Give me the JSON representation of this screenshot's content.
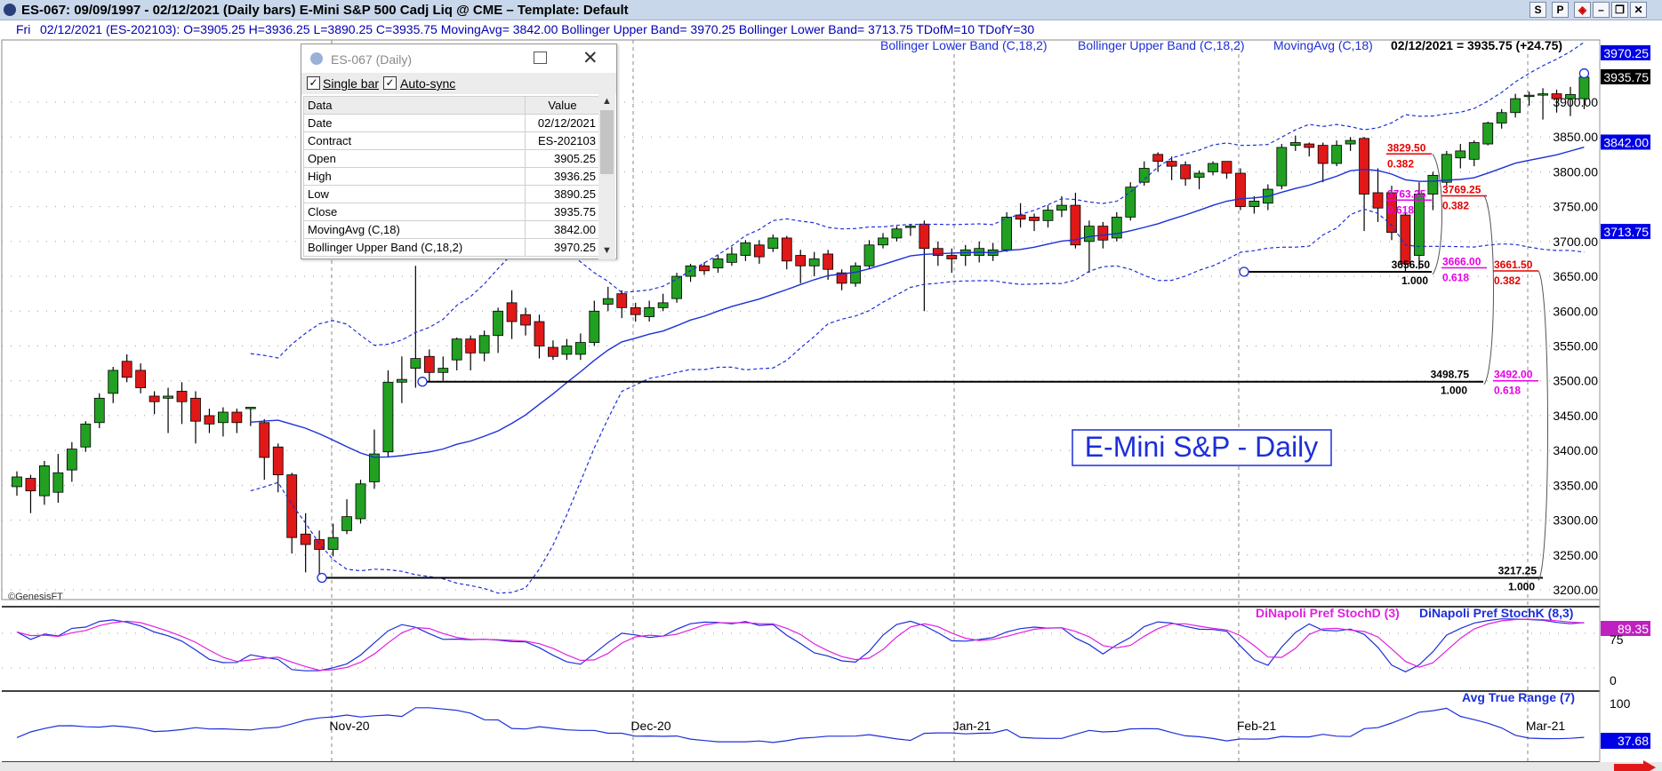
{
  "window": {
    "title": "ES-067:  09/09/1997 - 02/12/2021  (Daily bars)   E-Mini S&P 500 Cadj Liq @ CME  –  Template: Default",
    "buttons": [
      "S",
      "P"
    ]
  },
  "infobar": {
    "day": "Fri",
    "text": "02/12/2021 (ES-202103):  O=3905.25  H=3936.25  L=3890.25  C=3935.75  MovingAvg= 3842.00  Bollinger Upper Band= 3970.25  Bollinger Lower Band= 3713.75  TDofM=10  TDofY=30"
  },
  "data_window": {
    "title": "ES-067 (Daily)",
    "single_bar": "Single bar",
    "auto_sync": "Auto-sync",
    "headers": [
      "Data",
      "Value"
    ],
    "rows": [
      [
        "Date",
        "02/12/2021"
      ],
      [
        "Contract",
        "ES-202103"
      ],
      [
        "Open",
        "3905.25"
      ],
      [
        "High",
        "3936.25"
      ],
      [
        "Low",
        "3890.25"
      ],
      [
        "Close",
        "3935.75"
      ],
      [
        "MovingAvg (C,18)",
        "3842.00"
      ],
      [
        "Bollinger Upper Band (C,18,2)",
        "3970.25"
      ]
    ]
  },
  "chart_data": {
    "type": "candlestick",
    "title": "E-Mini S&P - Daily",
    "copyright": "©GenesisFT",
    "legend": [
      "Bollinger Lower Band (C,18,2)",
      "Bollinger Upper Band (C,18,2)",
      "MovingAvg (C,18)"
    ],
    "last_value_text": "02/12/2021 = 3935.75 (+24.75)",
    "x_ticks": [
      "Nov-20",
      "Dec-20",
      "Jan-21",
      "Feb-21",
      "Mar-21"
    ],
    "y_ticks": [
      "3200.00",
      "3250.00",
      "3300.00",
      "3350.00",
      "3400.00",
      "3450.00",
      "3500.00",
      "3550.00",
      "3600.00",
      "3650.00",
      "3700.00",
      "3750.00",
      "3800.00",
      "3850.00",
      "3900.00"
    ],
    "ylim": [
      3195,
      3985
    ],
    "price_labels": [
      {
        "text": "3970.25",
        "value": 3970.25,
        "color": "#0000e6"
      },
      {
        "text": "3935.75",
        "value": 3935.75,
        "color": "#000000"
      },
      {
        "text": "3842.00",
        "value": 3842.0,
        "color": "#0000e6"
      },
      {
        "text": "3713.75",
        "value": 3713.75,
        "color": "#0000e6"
      }
    ],
    "candles": [
      [
        3348,
        3362,
        3335,
        3370
      ],
      [
        3360,
        3342,
        3310,
        3365
      ],
      [
        3335,
        3378,
        3322,
        3385
      ],
      [
        3340,
        3368,
        3325,
        3395
      ],
      [
        3372,
        3402,
        3355,
        3412
      ],
      [
        3405,
        3438,
        3398,
        3442
      ],
      [
        3440,
        3475,
        3432,
        3482
      ],
      [
        3482,
        3515,
        3468,
        3520
      ],
      [
        3528,
        3505,
        3498,
        3538
      ],
      [
        3515,
        3490,
        3482,
        3525
      ],
      [
        3478,
        3470,
        3452,
        3485
      ],
      [
        3475,
        3478,
        3425,
        3490
      ],
      [
        3485,
        3470,
        3438,
        3498
      ],
      [
        3475,
        3442,
        3410,
        3485
      ],
      [
        3450,
        3438,
        3425,
        3460
      ],
      [
        3440,
        3455,
        3420,
        3462
      ],
      [
        3455,
        3440,
        3425,
        3460
      ],
      [
        3460,
        3462,
        3435,
        3462
      ],
      [
        3440,
        3390,
        3358,
        3445
      ],
      [
        3405,
        3365,
        3340,
        3410
      ],
      [
        3365,
        3275,
        3252,
        3368
      ],
      [
        3280,
        3265,
        3225,
        3310
      ],
      [
        3272,
        3258,
        3217,
        3285
      ],
      [
        3258,
        3275,
        3248,
        3295
      ],
      [
        3285,
        3305,
        3280,
        3330
      ],
      [
        3302,
        3352,
        3295,
        3358
      ],
      [
        3355,
        3395,
        3345,
        3430
      ],
      [
        3398,
        3498,
        3390,
        3515
      ],
      [
        3498,
        3502,
        3468,
        3535
      ],
      [
        3518,
        3532,
        3490,
        3665
      ],
      [
        3535,
        3512,
        3498,
        3545
      ],
      [
        3512,
        3518,
        3500,
        3535
      ],
      [
        3530,
        3560,
        3515,
        3562
      ],
      [
        3560,
        3540,
        3515,
        3565
      ],
      [
        3540,
        3565,
        3528,
        3572
      ],
      [
        3565,
        3600,
        3540,
        3605
      ],
      [
        3612,
        3585,
        3560,
        3630
      ],
      [
        3595,
        3580,
        3565,
        3605
      ],
      [
        3585,
        3550,
        3532,
        3595
      ],
      [
        3548,
        3535,
        3530,
        3558
      ],
      [
        3538,
        3550,
        3530,
        3560
      ],
      [
        3538,
        3555,
        3530,
        3568
      ],
      [
        3555,
        3600,
        3550,
        3615
      ],
      [
        3610,
        3618,
        3600,
        3635
      ],
      [
        3625,
        3605,
        3590,
        3630
      ],
      [
        3605,
        3595,
        3585,
        3612
      ],
      [
        3592,
        3605,
        3585,
        3615
      ],
      [
        3605,
        3612,
        3600,
        3625
      ],
      [
        3618,
        3650,
        3612,
        3655
      ],
      [
        3650,
        3665,
        3642,
        3668
      ],
      [
        3665,
        3658,
        3652,
        3670
      ],
      [
        3662,
        3675,
        3655,
        3680
      ],
      [
        3670,
        3682,
        3665,
        3692
      ],
      [
        3680,
        3698,
        3672,
        3702
      ],
      [
        3695,
        3678,
        3668,
        3702
      ],
      [
        3690,
        3705,
        3685,
        3710
      ],
      [
        3705,
        3672,
        3660,
        3708
      ],
      [
        3680,
        3665,
        3640,
        3688
      ],
      [
        3665,
        3675,
        3650,
        3685
      ],
      [
        3682,
        3660,
        3645,
        3688
      ],
      [
        3655,
        3640,
        3630,
        3660
      ],
      [
        3640,
        3665,
        3635,
        3670
      ],
      [
        3665,
        3695,
        3660,
        3702
      ],
      [
        3695,
        3705,
        3690,
        3712
      ],
      [
        3705,
        3718,
        3700,
        3722
      ],
      [
        3722,
        3722,
        3708,
        3725
      ],
      [
        3725,
        3690,
        3600,
        3730
      ],
      [
        3690,
        3680,
        3665,
        3700
      ],
      [
        3680,
        3675,
        3655,
        3690
      ],
      [
        3680,
        3688,
        3665,
        3695
      ],
      [
        3680,
        3690,
        3670,
        3700
      ],
      [
        3680,
        3688,
        3672,
        3698
      ],
      [
        3688,
        3735,
        3685,
        3742
      ],
      [
        3738,
        3732,
        3720,
        3755
      ],
      [
        3735,
        3730,
        3715,
        3740
      ],
      [
        3730,
        3745,
        3720,
        3752
      ],
      [
        3745,
        3752,
        3735,
        3765
      ],
      [
        3752,
        3695,
        3690,
        3770
      ],
      [
        3700,
        3722,
        3655,
        3730
      ],
      [
        3722,
        3702,
        3690,
        3728
      ],
      [
        3705,
        3735,
        3700,
        3742
      ],
      [
        3735,
        3778,
        3730,
        3785
      ],
      [
        3785,
        3805,
        3780,
        3815
      ],
      [
        3825,
        3815,
        3800,
        3828
      ],
      [
        3815,
        3808,
        3788,
        3822
      ],
      [
        3810,
        3790,
        3780,
        3815
      ],
      [
        3792,
        3798,
        3775,
        3802
      ],
      [
        3800,
        3812,
        3795,
        3815
      ],
      [
        3815,
        3798,
        3790,
        3815
      ],
      [
        3798,
        3750,
        3745,
        3805
      ],
      [
        3750,
        3758,
        3740,
        3765
      ],
      [
        3755,
        3775,
        3745,
        3782
      ],
      [
        3780,
        3835,
        3775,
        3840
      ],
      [
        3838,
        3842,
        3830,
        3852
      ],
      [
        3840,
        3835,
        3822,
        3842
      ],
      [
        3838,
        3812,
        3785,
        3842
      ],
      [
        3812,
        3838,
        3808,
        3845
      ],
      [
        3840,
        3845,
        3830,
        3850
      ],
      [
        3848,
        3768,
        3715,
        3850
      ],
      [
        3770,
        3748,
        3728,
        3805
      ],
      [
        3770,
        3713,
        3702,
        3780
      ],
      [
        3738,
        3668,
        3656,
        3742
      ],
      [
        3680,
        3768,
        3660,
        3785
      ],
      [
        3768,
        3795,
        3745,
        3800
      ],
      [
        3785,
        3825,
        3780,
        3830
      ],
      [
        3820,
        3830,
        3805,
        3840
      ],
      [
        3818,
        3842,
        3808,
        3845
      ],
      [
        3840,
        3870,
        3838,
        3872
      ],
      [
        3870,
        3885,
        3862,
        3890
      ],
      [
        3885,
        3905,
        3878,
        3912
      ],
      [
        3908,
        3910,
        3895,
        3915
      ],
      [
        3910,
        3912,
        3875,
        3920
      ],
      [
        3912,
        3905,
        3885,
        3918
      ],
      [
        3905,
        3911,
        3880,
        3922
      ],
      [
        3905,
        3936,
        3890,
        3936
      ]
    ],
    "levels": [
      {
        "value": 3656.5,
        "label": "3656.50",
        "ratio": "1.000",
        "color": "#000000"
      },
      {
        "value": 3498.75,
        "label": "3498.75",
        "ratio": "1.000",
        "color": "#000000"
      },
      {
        "value": 3217.25,
        "label": "3217.25",
        "ratio": "1.000",
        "color": "#000000"
      }
    ],
    "fib_labels": [
      {
        "text": "3829.50",
        "ratio": "0.382",
        "value": 3829.5,
        "color": "#e60000"
      },
      {
        "text": "3769.25",
        "ratio": "0.382",
        "value": 3769.25,
        "color": "#e60000"
      },
      {
        "text": "3763.25",
        "ratio": "0.618",
        "value": 3763.25,
        "color": "#e600e6"
      },
      {
        "text": "3666.00",
        "ratio": "0.618",
        "value": 3666.0,
        "color": "#e600e6"
      },
      {
        "text": "3661.50",
        "ratio": "0.382",
        "value": 3661.5,
        "color": "#e60000"
      },
      {
        "text": "3492.00",
        "ratio": "0.618",
        "value": 3492.0,
        "color": "#e600e6"
      }
    ],
    "stoch": {
      "title_d": "DiNapoli Pref StochD (3)",
      "title_k": "DiNapoli Pref StochK (8,3)",
      "value_label": "89.35",
      "y_ticks": [
        "75",
        "0"
      ]
    },
    "atr": {
      "title": "Avg True Range (7)",
      "value_label": "37.68",
      "y_ticks": [
        "100"
      ]
    }
  }
}
